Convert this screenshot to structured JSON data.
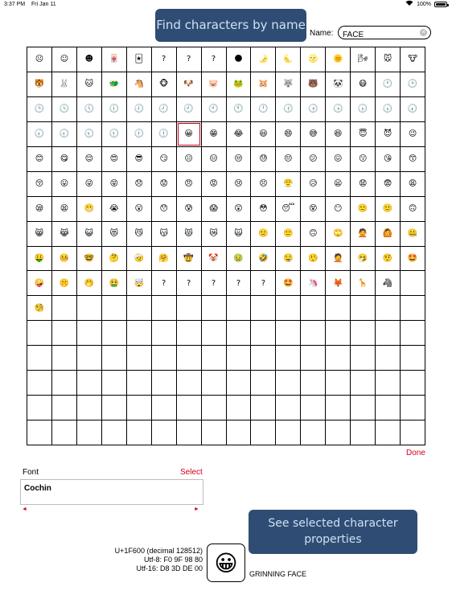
{
  "status": {
    "time": "3:37 PM",
    "date": "Fri Jan 11",
    "battery_text": "100%",
    "battery_level": 1.0
  },
  "callouts": {
    "find": "Find characters by name",
    "properties": "See selected character properties"
  },
  "search": {
    "label": "Name:",
    "value": "FACE",
    "clear_icon": "clear-icon"
  },
  "grid": {
    "columns": 16,
    "rows": 16,
    "selected_index": 54,
    "cells": [
      "☹",
      "☺",
      "☻",
      "🀄",
      "🃏",
      "?",
      "?",
      "?",
      "🌑",
      "🌛",
      "🌜",
      "🌝",
      "🌞",
      "🌬",
      "🐭",
      "🐮",
      "🐯",
      "🐰",
      "🐱",
      "🐲",
      "🐴",
      "🐵",
      "🐶",
      "🐷",
      "🐸",
      "🐹",
      "🐺",
      "🐻",
      "🐼",
      "😷",
      "🕐",
      "🕑",
      "🕒",
      "🕓",
      "🕔",
      "🕕",
      "🕖",
      "🕗",
      "🕘",
      "🕙",
      "🕚",
      "🕛",
      "🕜",
      "🕝",
      "🕞",
      "🕟",
      "🕠",
      "🕡",
      "🕢",
      "🕣",
      "🕤",
      "🕥",
      "🕦",
      "🕧",
      "😀",
      "😁",
      "😂",
      "😃",
      "😄",
      "😅",
      "😆",
      "😇",
      "😈",
      "😉",
      "😊",
      "😋",
      "😌",
      "😍",
      "😎",
      "😏",
      "😐",
      "😑",
      "😒",
      "😓",
      "😔",
      "😕",
      "😖",
      "😗",
      "😘",
      "😙",
      "😚",
      "😛",
      "😜",
      "😝",
      "😞",
      "😟",
      "😠",
      "😡",
      "😢",
      "😣",
      "😤",
      "😥",
      "😦",
      "😧",
      "😨",
      "😩",
      "😪",
      "😫",
      "😬",
      "😭",
      "😮",
      "😯",
      "😰",
      "😱",
      "😲",
      "😳",
      "😴",
      "😵",
      "😶",
      "🙁",
      "🙂",
      "🙃",
      "😸",
      "😹",
      "😺",
      "😻",
      "😼",
      "😽",
      "😾",
      "😿",
      "🙀",
      "🙁",
      "🙂",
      "🙃",
      "🙄",
      "🙅",
      "🙆",
      "🤐",
      "🤑",
      "🤒",
      "🤓",
      "🤔",
      "🤕",
      "🤗",
      "🤠",
      "🤡",
      "🤢",
      "🤣",
      "🤤",
      "🤥",
      "🤦",
      "🤧",
      "🤨",
      "🤩",
      "🤪",
      "🤫",
      "🤭",
      "🤮",
      "🤯",
      "?",
      "?",
      "?",
      "?",
      "?",
      "🤩",
      "🦄",
      "🦊",
      "🦒",
      "🦓",
      "",
      "🧐",
      "",
      "",
      "",
      "",
      "",
      "",
      "",
      "",
      "",
      "",
      "",
      "",
      "",
      "",
      "",
      "",
      "",
      "",
      "",
      "",
      "",
      "",
      "",
      "",
      "",
      "",
      "",
      "",
      "",
      "",
      "",
      "",
      "",
      "",
      "",
      "",
      "",
      "",
      "",
      "",
      "",
      "",
      "",
      "",
      "",
      "",
      "",
      "",
      "",
      "",
      "",
      "",
      "",
      "",
      "",
      "",
      "",
      "",
      "",
      "",
      "",
      "",
      "",
      "",
      "",
      "",
      "",
      "",
      "",
      "",
      "",
      "",
      "",
      "",
      "",
      "",
      "",
      "",
      "",
      "",
      "",
      "",
      "",
      "",
      "",
      "",
      "",
      "",
      "",
      "",
      "",
      "",
      "",
      "",
      ""
    ]
  },
  "done_label": "Done",
  "font": {
    "label": "Font",
    "select_label": "Select",
    "value": "Cochin",
    "left_arrow": "◄",
    "right_arrow": "►"
  },
  "selected": {
    "glyph": "😀",
    "codepoint": "U+1F600 (decimal 128512)",
    "utf8": "Utf-8: F0 9F 98 80",
    "utf16": "Utf-16: D8 3D DE 00",
    "name": "GRINNING FACE"
  }
}
